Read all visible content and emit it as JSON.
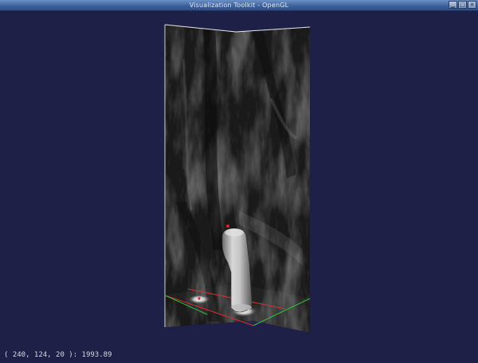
{
  "window": {
    "title": "Visualization Toolkit - OpenGL",
    "minimize_glyph": "▁",
    "maximize_glyph": "□",
    "close_glyph": "✕"
  },
  "viewport": {
    "background_color": "#1e2047",
    "scene": "volume-slice-render",
    "axis_line_colors": {
      "x": "#d62a2a",
      "y": "#2fbf3a"
    },
    "marker_color": "#e02020"
  },
  "status": {
    "readout": "( 240, 124, 20 ): 1993.89"
  }
}
